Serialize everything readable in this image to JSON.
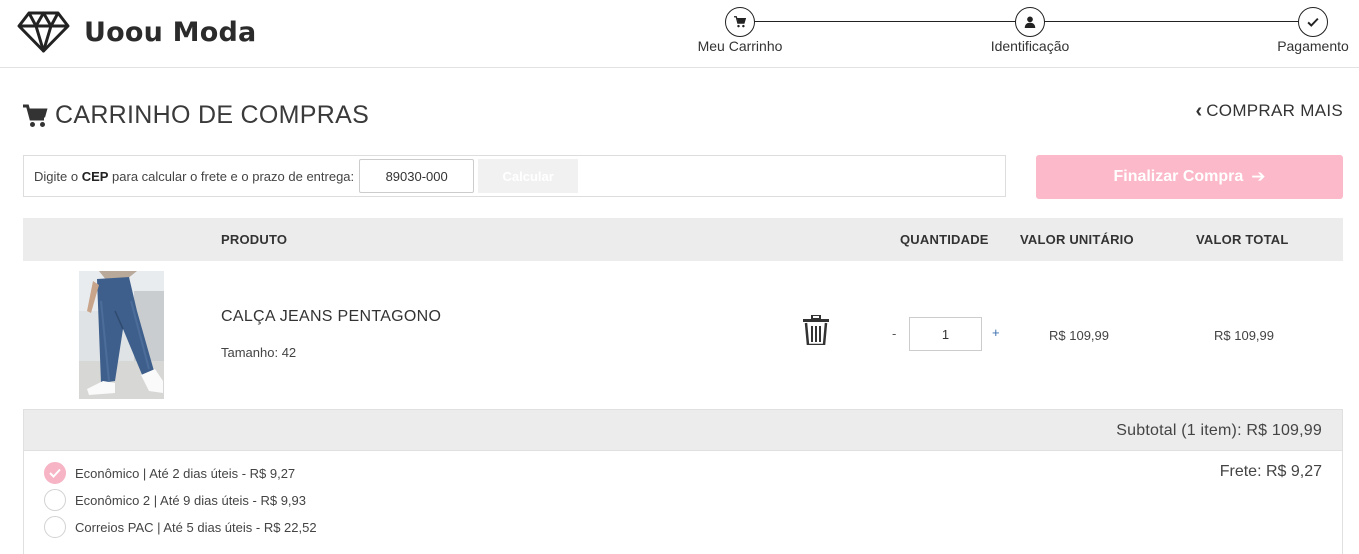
{
  "brand": {
    "name": "Uoou Moda",
    "logo_icon": "diamond-icon"
  },
  "steps": [
    {
      "label": "Meu Carrinho",
      "icon": "cart-icon"
    },
    {
      "label": "Identificação",
      "icon": "user-icon"
    },
    {
      "label": "Pagamento",
      "icon": "check-icon"
    }
  ],
  "page": {
    "title": "CARRINHO DE COMPRAS",
    "buy_more": "COMPRAR MAIS"
  },
  "cep": {
    "text_before": "Digite o ",
    "text_bold": "CEP",
    "text_after": " para calcular o frete e o prazo de entrega:",
    "value": "89030-000",
    "button": "Calcular"
  },
  "finish_button": "Finalizar Compra",
  "table": {
    "headers": {
      "product": "PRODUTO",
      "quantity": "QUANTIDADE",
      "unit_price": "VALOR UNITÁRIO",
      "total_price": "VALOR TOTAL"
    }
  },
  "item": {
    "name": "CALÇA JEANS PENTAGONO",
    "size": "Tamanho: 42",
    "quantity": "1",
    "minus": "-",
    "plus": "+",
    "unit_price": "R$ 109,99",
    "total_price": "R$ 109,99"
  },
  "subtotal": "Subtotal (1 item): R$ 109,99",
  "shipping": {
    "options": [
      {
        "label": "Econômico | Até 2 dias úteis - R$ 9,27",
        "selected": true
      },
      {
        "label": "Econômico 2 | Até 9 dias úteis - R$ 9,93",
        "selected": false
      },
      {
        "label": "Correios PAC | Até 5 dias úteis - R$ 22,52",
        "selected": false
      }
    ],
    "frete": "Frete: R$ 9,27"
  },
  "colors": {
    "accent_pink": "#fbb9c9",
    "radio_checked": "#f6b4c5",
    "header_bg": "#ececed"
  }
}
